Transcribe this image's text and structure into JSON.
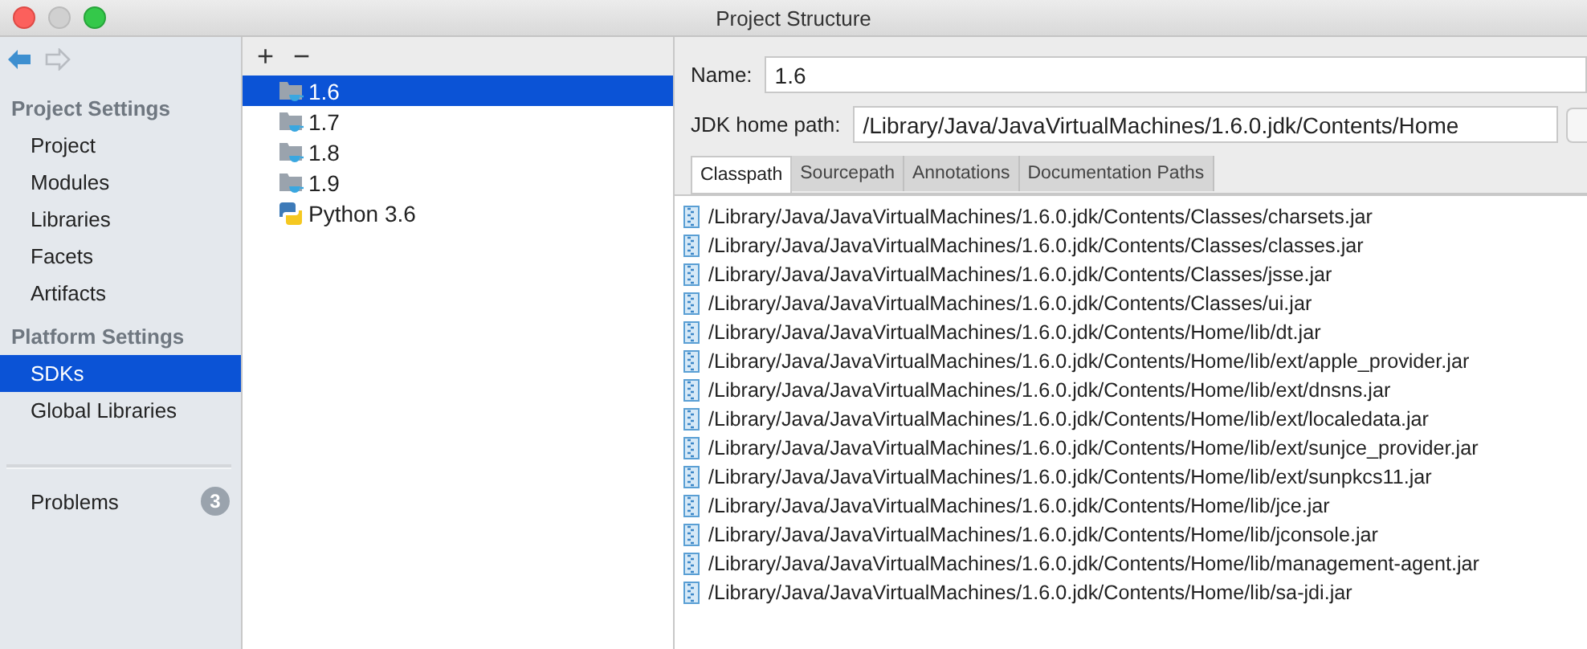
{
  "window": {
    "title": "Project Structure"
  },
  "sidebar": {
    "sections": [
      {
        "title": "Project Settings",
        "items": [
          {
            "label": "Project",
            "selected": false
          },
          {
            "label": "Modules",
            "selected": false
          },
          {
            "label": "Libraries",
            "selected": false
          },
          {
            "label": "Facets",
            "selected": false
          },
          {
            "label": "Artifacts",
            "selected": false
          }
        ]
      },
      {
        "title": "Platform Settings",
        "items": [
          {
            "label": "SDKs",
            "selected": true
          },
          {
            "label": "Global Libraries",
            "selected": false
          }
        ]
      }
    ],
    "problems": {
      "label": "Problems",
      "count": "3"
    }
  },
  "sdk_list": {
    "toolbar": [
      "+",
      "−"
    ],
    "items": [
      {
        "label": "1.6",
        "kind": "jdk",
        "selected": true
      },
      {
        "label": "1.7",
        "kind": "jdk",
        "selected": false
      },
      {
        "label": "1.8",
        "kind": "jdk",
        "selected": false
      },
      {
        "label": "1.9",
        "kind": "jdk",
        "selected": false
      },
      {
        "label": "Python 3.6",
        "kind": "python",
        "selected": false
      }
    ]
  },
  "details": {
    "name_label": "Name:",
    "name_value": "1.6",
    "home_label": "JDK home path:",
    "home_value": "/Library/Java/JavaVirtualMachines/1.6.0.jdk/Contents/Home",
    "tabs": [
      {
        "label": "Classpath",
        "selected": true
      },
      {
        "label": "Sourcepath",
        "selected": false
      },
      {
        "label": "Annotations",
        "selected": false
      },
      {
        "label": "Documentation Paths",
        "selected": false
      }
    ],
    "classpath": [
      "/Library/Java/JavaVirtualMachines/1.6.0.jdk/Contents/Classes/charsets.jar",
      "/Library/Java/JavaVirtualMachines/1.6.0.jdk/Contents/Classes/classes.jar",
      "/Library/Java/JavaVirtualMachines/1.6.0.jdk/Contents/Classes/jsse.jar",
      "/Library/Java/JavaVirtualMachines/1.6.0.jdk/Contents/Classes/ui.jar",
      "/Library/Java/JavaVirtualMachines/1.6.0.jdk/Contents/Home/lib/dt.jar",
      "/Library/Java/JavaVirtualMachines/1.6.0.jdk/Contents/Home/lib/ext/apple_provider.jar",
      "/Library/Java/JavaVirtualMachines/1.6.0.jdk/Contents/Home/lib/ext/dnsns.jar",
      "/Library/Java/JavaVirtualMachines/1.6.0.jdk/Contents/Home/lib/ext/localedata.jar",
      "/Library/Java/JavaVirtualMachines/1.6.0.jdk/Contents/Home/lib/ext/sunjce_provider.jar",
      "/Library/Java/JavaVirtualMachines/1.6.0.jdk/Contents/Home/lib/ext/sunpkcs11.jar",
      "/Library/Java/JavaVirtualMachines/1.6.0.jdk/Contents/Home/lib/jce.jar",
      "/Library/Java/JavaVirtualMachines/1.6.0.jdk/Contents/Home/lib/jconsole.jar",
      "/Library/Java/JavaVirtualMachines/1.6.0.jdk/Contents/Home/lib/management-agent.jar",
      "/Library/Java/JavaVirtualMachines/1.6.0.jdk/Contents/Home/lib/sa-jdi.jar"
    ]
  }
}
